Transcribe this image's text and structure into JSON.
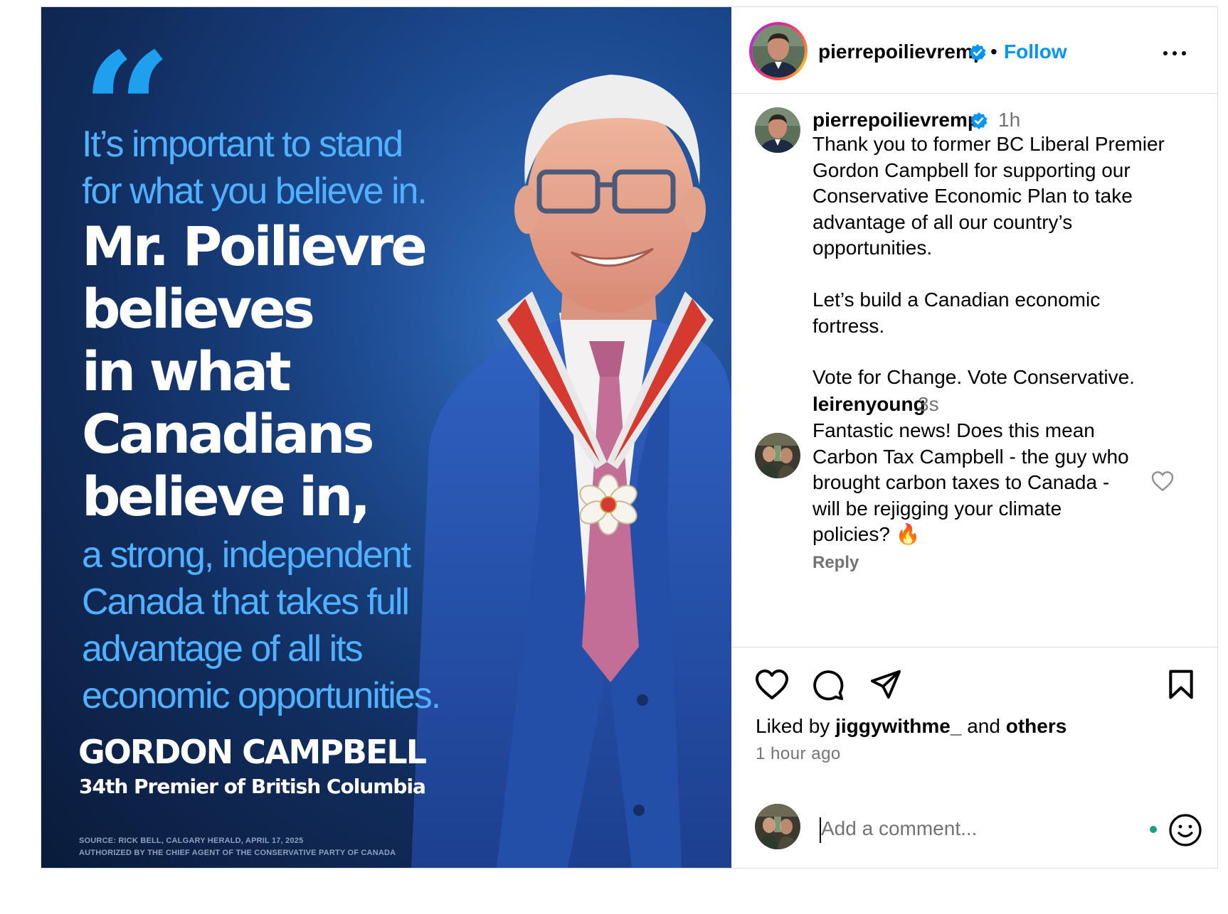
{
  "media": {
    "quote_mark": "“",
    "lines_light_top": [
      "It’s important to stand",
      "for what you believe in."
    ],
    "lines_bold": [
      "Mr. Poilievre",
      "believes",
      "in what",
      "Canadians",
      "believe in,"
    ],
    "lines_light_bottom": [
      "a strong, independent",
      "Canada that takes full",
      "advantage of all its",
      "economic opportunities."
    ],
    "name": "GORDON CAMPBELL",
    "subtitle": "34th Premier of British Columbia",
    "source": "SOURCE: RICK BELL, CALGARY HERALD, APRIL 17, 2025",
    "authorized": "AUTHORIZED BY THE CHIEF AGENT OF THE CONSERVATIVE PARTY OF CANADA"
  },
  "header": {
    "username": "pierrepoilievremp",
    "separator": "•",
    "follow_label": "Follow",
    "more_icon": "more-horizontal-icon"
  },
  "caption": {
    "username": "pierrepoilievremp",
    "time": "1h",
    "paragraphs": [
      [
        "Thank you to former BC Liberal Premier",
        "Gordon Campbell for supporting our",
        "Conservative Economic Plan to take",
        "advantage of all our country’s",
        "opportunities."
      ],
      [
        "Let’s build a Canadian economic",
        "fortress."
      ],
      [
        "Vote for Change. Vote Conservative."
      ]
    ]
  },
  "comment": {
    "username": "leirenyoung",
    "time": "3s",
    "lines": [
      "Fantastic news! Does this mean",
      "Carbon Tax Campbell - the guy who",
      "brought carbon taxes to Canada -",
      "will be rejigging your climate",
      "policies? 🔥"
    ],
    "reply_label": "Reply"
  },
  "actions": {
    "liked_prefix": "Liked by",
    "liked_user": "jiggywithme_",
    "liked_and": "and",
    "liked_others": "others",
    "time_ago": "1 hour ago"
  },
  "composer": {
    "placeholder": "Add a comment..."
  },
  "colors": {
    "accent": "#0095f6",
    "secondary_text": "#737373",
    "quote_blue": "#4fb1ff",
    "verified": "#0095f6"
  }
}
